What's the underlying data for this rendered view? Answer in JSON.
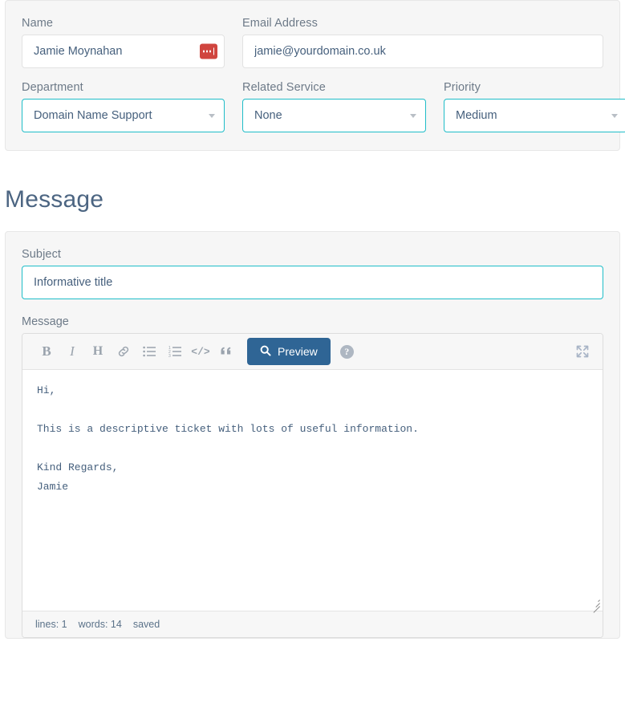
{
  "details_card": {
    "fields": [
      {
        "label": "Name",
        "value": "Jamie Moynahan",
        "placeholder": "Name",
        "type": "text",
        "icon": "lastpass-fill-icon"
      },
      {
        "label": "Email Address",
        "value": "jamie@yourdomain.co.uk",
        "placeholder": "Email Address",
        "type": "text"
      },
      {
        "label": "Department",
        "value": "Domain Name Support",
        "type": "select",
        "icon": "chevron-down-icon"
      },
      {
        "label": "Related Service",
        "value": "None",
        "type": "select",
        "icon": "chevron-down-icon"
      },
      {
        "label": "Priority",
        "value": "Medium",
        "type": "select",
        "icon": "chevron-down-icon"
      }
    ]
  },
  "message_section": {
    "heading": "Message",
    "subject": {
      "label": "Subject",
      "value": "Informative title",
      "placeholder": "Subject"
    },
    "message": {
      "label": "Message",
      "body": "Hi,\n\nThis is a descriptive ticket with lots of useful information.\n\nKind Regards,\nJamie"
    },
    "toolbar": {
      "buttons": [
        {
          "name": "bold-icon",
          "glyph": "B"
        },
        {
          "name": "italic-icon",
          "glyph": "I"
        },
        {
          "name": "heading-icon",
          "glyph": "H"
        },
        {
          "name": "link-icon",
          "glyph": "link"
        },
        {
          "name": "unordered-list-icon",
          "glyph": "ul"
        },
        {
          "name": "ordered-list-icon",
          "glyph": "ol"
        },
        {
          "name": "code-icon",
          "glyph": "</>"
        },
        {
          "name": "quote-icon",
          "glyph": "“"
        }
      ],
      "preview_label": "Preview",
      "preview_icon": "search-icon",
      "help_icon": "help-circle-icon",
      "help_glyph": "?",
      "fullscreen_icon": "fullscreen-expand-icon"
    },
    "status": {
      "lines": "lines: 1",
      "words": "words: 14",
      "saved": "saved"
    }
  },
  "colors": {
    "accent_teal": "#1fbdc8",
    "preview_blue": "#2f6595",
    "badge_red": "#d0453f",
    "card_bg": "#f6f6f6",
    "text_blue": "#46607d",
    "label_gray": "#6d7a88"
  }
}
